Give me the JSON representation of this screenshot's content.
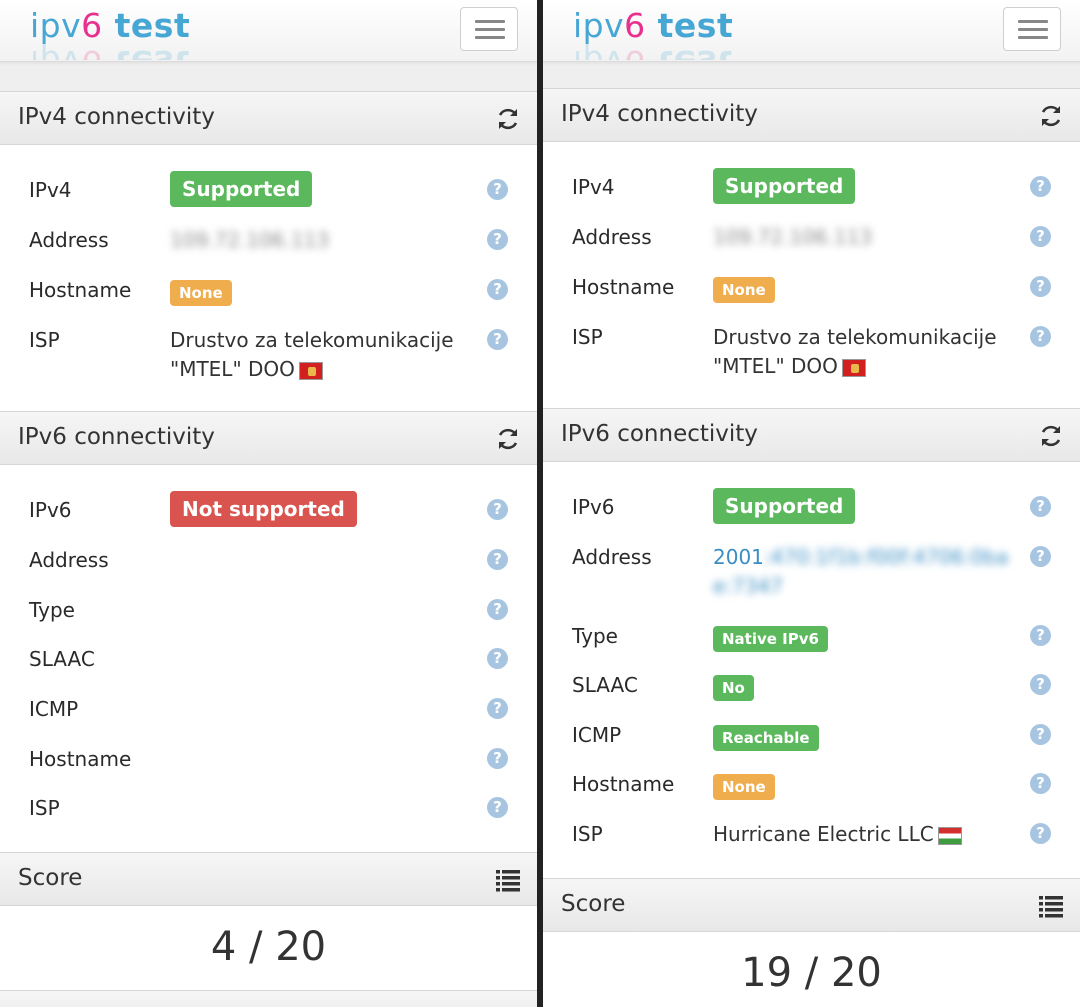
{
  "logo": {
    "part1": "ipv",
    "part2": "6",
    "part3": " test"
  },
  "left": {
    "ipv4": {
      "title": "IPv4 connectivity",
      "rows": {
        "status": {
          "label": "IPv4",
          "value": "Supported"
        },
        "address": {
          "label": "Address",
          "value": "109.72.106.113"
        },
        "hostname": {
          "label": "Hostname",
          "value": "None"
        },
        "isp": {
          "label": "ISP",
          "line1": "Drustvo za telekomunikacije",
          "line2": "\"MTEL\" DOO",
          "flag": "ME"
        }
      }
    },
    "ipv6": {
      "title": "IPv6 connectivity",
      "rows": {
        "status": {
          "label": "IPv6",
          "value": "Not supported"
        },
        "address": {
          "label": "Address"
        },
        "type": {
          "label": "Type"
        },
        "slaac": {
          "label": "SLAAC"
        },
        "icmp": {
          "label": "ICMP"
        },
        "hostname": {
          "label": "Hostname"
        },
        "isp": {
          "label": "ISP"
        }
      }
    },
    "score": {
      "title": "Score",
      "value": "4 / 20"
    }
  },
  "right": {
    "ipv4": {
      "title": "IPv4 connectivity",
      "rows": {
        "status": {
          "label": "IPv4",
          "value": "Supported"
        },
        "address": {
          "label": "Address",
          "value": "109.72.106.113"
        },
        "hostname": {
          "label": "Hostname",
          "value": "None"
        },
        "isp": {
          "label": "ISP",
          "line1": "Drustvo za telekomunikacije",
          "line2": "\"MTEL\" DOO",
          "flag": "ME"
        }
      }
    },
    "ipv6": {
      "title": "IPv6 connectivity",
      "rows": {
        "status": {
          "label": "IPv6",
          "value": "Supported"
        },
        "address": {
          "label": "Address",
          "visible": "2001",
          "hidden1": ":470:1f1b:f00f:4706:0ba",
          "hidden2": "e:7347"
        },
        "type": {
          "label": "Type",
          "value": "Native IPv6"
        },
        "slaac": {
          "label": "SLAAC",
          "value": "No"
        },
        "icmp": {
          "label": "ICMP",
          "value": "Reachable"
        },
        "hostname": {
          "label": "Hostname",
          "value": "None"
        },
        "isp": {
          "label": "ISP",
          "value": "Hurricane Electric LLC",
          "flag": "HU"
        }
      }
    },
    "score": {
      "title": "Score",
      "value": "19 / 20"
    }
  },
  "help_glyph": "?",
  "icons": [
    "refresh-icon",
    "list-icon",
    "menu-icon",
    "help-icon"
  ],
  "colors": {
    "green": "#5cb85c",
    "red": "#d9534f",
    "orange": "#f0ad4e",
    "logo_blue": "#46a6d4",
    "logo_pink": "#e8318e"
  }
}
